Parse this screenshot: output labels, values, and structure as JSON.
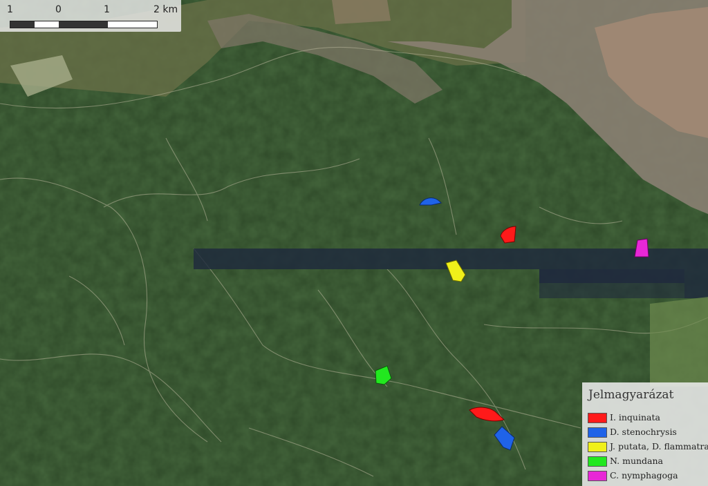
{
  "scale": {
    "labels": [
      "1",
      "0",
      "1",
      "2 km"
    ]
  },
  "legend": {
    "title": "Jelmagyarázat",
    "items": [
      {
        "label": "I. inquinata",
        "color": "#ff1a1a"
      },
      {
        "label": "D. stenochrysis",
        "color": "#1f63e8"
      },
      {
        "label": "J. putata, D. flammatra",
        "color": "#f0f01a"
      },
      {
        "label": "N. mundana",
        "color": "#22e81f"
      },
      {
        "label": "C. nymphagoga",
        "color": "#e827d6"
      }
    ]
  }
}
